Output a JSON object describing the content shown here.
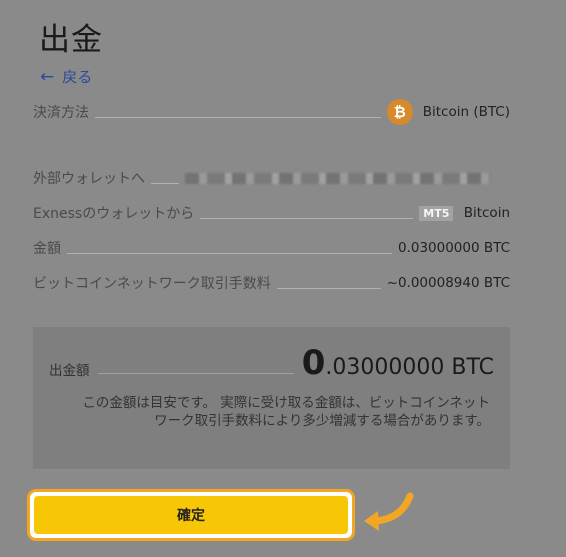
{
  "page": {
    "title": "出金",
    "back_label": "戻る"
  },
  "details": {
    "method_label": "決済方法",
    "method_value": "Bitcoin (BTC)",
    "btc_symbol": "₿",
    "to_wallet_label": "外部ウォレットへ",
    "from_label": "Exnessのウォレットから",
    "from_badge": "MT5",
    "from_value": "Bitcoin",
    "amount_label": "金額",
    "amount_value": "0.03000000 BTC",
    "fee_label": "ビットコインネットワーク取引手数料",
    "fee_value": "~0.00008940 BTC"
  },
  "summary": {
    "label": "出金額",
    "value_int": "0",
    "value_rest": ".03000000 BTC",
    "note": "この金額は目安です。 実際に受け取る金額は、ビットコインネットワーク取引手数料により多少増減する場合があります。"
  },
  "actions": {
    "confirm_label": "確定"
  },
  "colors": {
    "accent": "#f7c705",
    "highlight": "#f3a623",
    "btc": "#d88a2a"
  },
  "icons": {
    "back": "arrow-left-icon",
    "pointer": "pointing-arrow-icon",
    "coin": "bitcoin-icon"
  }
}
